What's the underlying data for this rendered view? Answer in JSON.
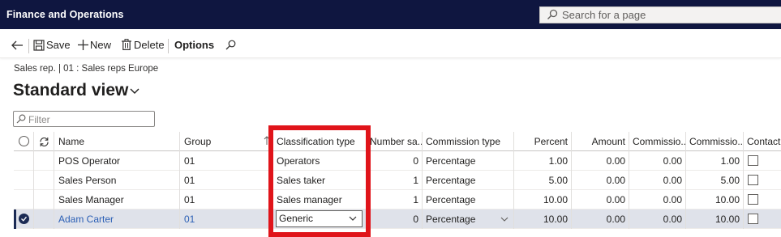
{
  "app": {
    "title": "Finance and Operations"
  },
  "search": {
    "placeholder": "Search for a page"
  },
  "actions": {
    "save": "Save",
    "new": "New",
    "delete": "Delete",
    "options": "Options"
  },
  "caption": "Sales rep.  | 01 : Sales reps Europe",
  "view_title": "Standard view",
  "filter": {
    "placeholder": "Filter"
  },
  "columns": {
    "name": "Name",
    "group": "Group",
    "classification": "Classification type",
    "number": "Number sa...",
    "commission_type": "Commission type",
    "percent": "Percent",
    "amount": "Amount",
    "comm1": "Commissio...",
    "comm2": "Commissio...",
    "contact": "Contact"
  },
  "rows": [
    {
      "name": "POS Operator",
      "group": "01",
      "classification": "Operators",
      "number": "0",
      "commission_type": "Percentage",
      "percent": "1.00",
      "amount": "0.00",
      "comm1": "0.00",
      "comm2": "1.00"
    },
    {
      "name": "Sales Person",
      "group": "01",
      "classification": "Sales taker",
      "number": "1",
      "commission_type": "Percentage",
      "percent": "5.00",
      "amount": "0.00",
      "comm1": "0.00",
      "comm2": "5.00"
    },
    {
      "name": "Sales Manager",
      "group": "01",
      "classification": "Sales manager",
      "number": "1",
      "commission_type": "Percentage",
      "percent": "10.00",
      "amount": "0.00",
      "comm1": "0.00",
      "comm2": "10.00"
    },
    {
      "name": "Adam Carter",
      "group": "01",
      "classification": "Generic",
      "number": "0",
      "commission_type": "Percentage",
      "percent": "10.00",
      "amount": "0.00",
      "comm1": "0.00",
      "comm2": "10.00"
    }
  ],
  "colors": {
    "topbar": "#0f1640",
    "highlight": "#e0141a",
    "link": "#2b5fb5",
    "selected_row": "#dfe2ea"
  },
  "icons": [
    "search-icon",
    "back-arrow-icon",
    "save-icon",
    "plus-icon",
    "trash-icon",
    "chevron-down-icon",
    "refresh-icon",
    "filter-icon",
    "sort-arrow-icon",
    "check-icon"
  ]
}
